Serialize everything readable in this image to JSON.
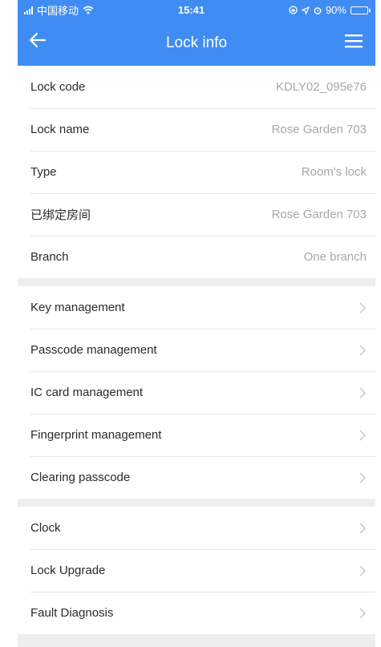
{
  "status_bar": {
    "carrier": "中国移动",
    "time": "15:41",
    "battery": "90%",
    "battery_level": 0.9
  },
  "nav": {
    "title": "Lock info",
    "back_icon": "arrow-left-icon",
    "menu_icon": "hamburger-menu-icon"
  },
  "info": [
    {
      "label": "Lock code",
      "value": "KDLY02_095e76"
    },
    {
      "label": "Lock name",
      "value": "Rose Garden 703"
    },
    {
      "label": "Type",
      "value": "Room's lock"
    },
    {
      "label": "已绑定房间",
      "value": "Rose Garden 703"
    },
    {
      "label": "Branch",
      "value": "One branch"
    }
  ],
  "management": [
    {
      "label": "Key management"
    },
    {
      "label": "Passcode management"
    },
    {
      "label": "IC card management"
    },
    {
      "label": "Fingerprint management"
    },
    {
      "label": "Clearing passcode"
    }
  ],
  "tools": [
    {
      "label": "Clock"
    },
    {
      "label": "Lock Upgrade"
    },
    {
      "label": "Fault Diagnosis"
    }
  ],
  "colors": {
    "accent": "#3f8cf3",
    "background": "#eeeeee"
  }
}
